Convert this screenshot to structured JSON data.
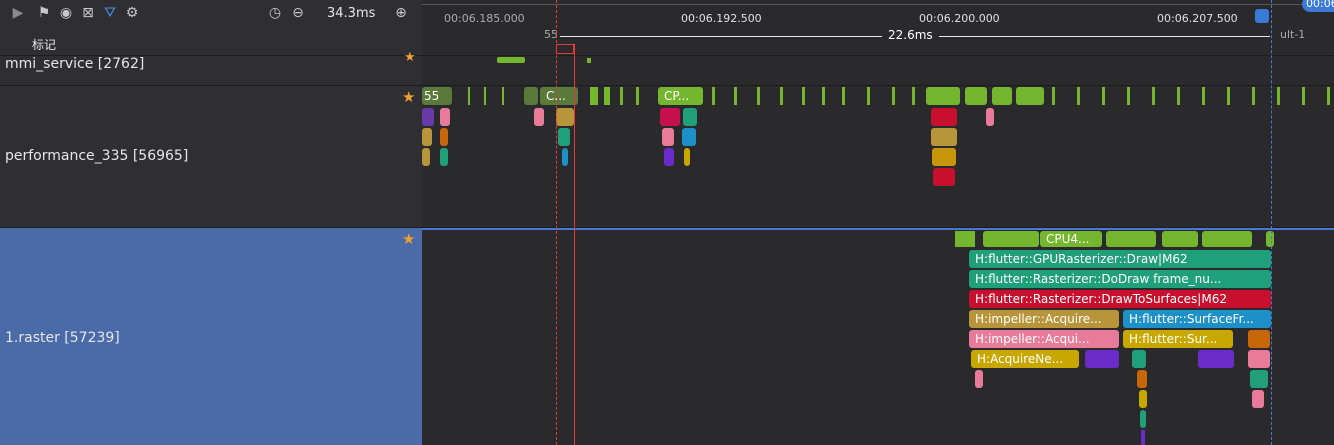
{
  "toolbar": {
    "duration": "34.3ms",
    "marks_label": "标记"
  },
  "timeline": {
    "ticks": [
      "00:06.185.000",
      "00:06.192.500",
      "00:06.200.000",
      "00:06.207.500"
    ],
    "range_label": "22.6ms",
    "range_left_fragment": "55",
    "range_right_fragment": "ult-1",
    "corner_badge": "00:06"
  },
  "lanes": [
    {
      "label": "mmi_service [2762]"
    },
    {
      "label": "performance_335 [56965]"
    },
    {
      "label": "1.raster [57239]"
    }
  ],
  "perf_slices": {
    "s1": "55",
    "s2": "C...",
    "s3": "CP..."
  },
  "raster_slices": {
    "cpu": "CPU4...",
    "gpu_draw": "H:flutter::GPURasterizer::Draw|M62",
    "do_draw": "H:flutter::Rasterizer::DoDraw frame_nu...",
    "draw_to_surfaces": "H:flutter::Rasterizer::DrawToSurfaces|M62",
    "impeller_acquire1": "H:impeller::Acquire...",
    "surface_frame": "H:flutter::SurfaceFr...",
    "impeller_acquire2": "H:impeller::Acqui...",
    "flutter_sur": "H:flutter::Sur...",
    "acquire_ne": "H:AcquireNe..."
  },
  "colors": {
    "green": "#74b72e",
    "teal": "#20a07a",
    "red": "#c8102e",
    "gold": "#b8953a",
    "blue": "#1e90c8",
    "pink": "#e87a9a",
    "purple": "#6a2bc8",
    "orange": "#c8660a",
    "selection": "#4a6aa8"
  }
}
